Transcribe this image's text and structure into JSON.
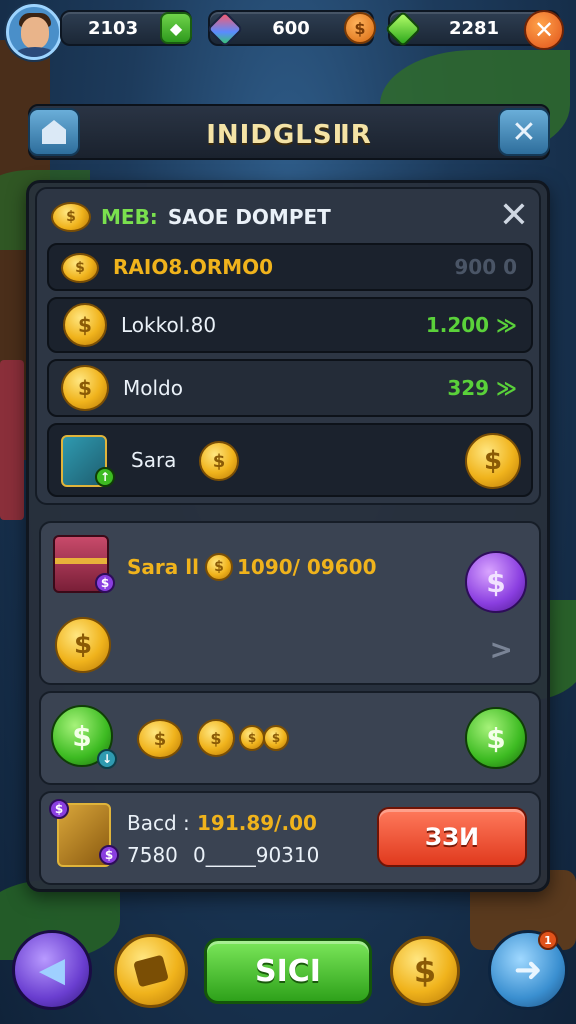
{
  "hud": {
    "player_level_value": "2103",
    "gems_value": "600",
    "coins_value": "2281"
  },
  "title": {
    "text": "INIDGLSⅡR"
  },
  "wallet": {
    "header_a": "MEB:",
    "header_b": "SAOE DOMPET",
    "rows": [
      {
        "label": "RAIO8.ORMO0",
        "value": "900 0"
      },
      {
        "label": "Lokkol.80",
        "value": "1.200 ≫"
      },
      {
        "label": "Moldo",
        "value": "329 ≫"
      }
    ],
    "sara_label": "Sara"
  },
  "lower": {
    "sara_line_label": "Sara ll",
    "sara_line_value": "1090/ 09600",
    "back_label": "Bacd :",
    "back_value": "191.89/.00",
    "amount_a": "7580",
    "amount_b": "0_____90310",
    "red_button": "ЗЗИ"
  },
  "bottom": {
    "main_button": "SICI",
    "notification_count": "1"
  },
  "colors": {
    "accent_green": "#7ae04e",
    "accent_gold": "#f0b31c",
    "danger_red": "#e03a1e"
  }
}
